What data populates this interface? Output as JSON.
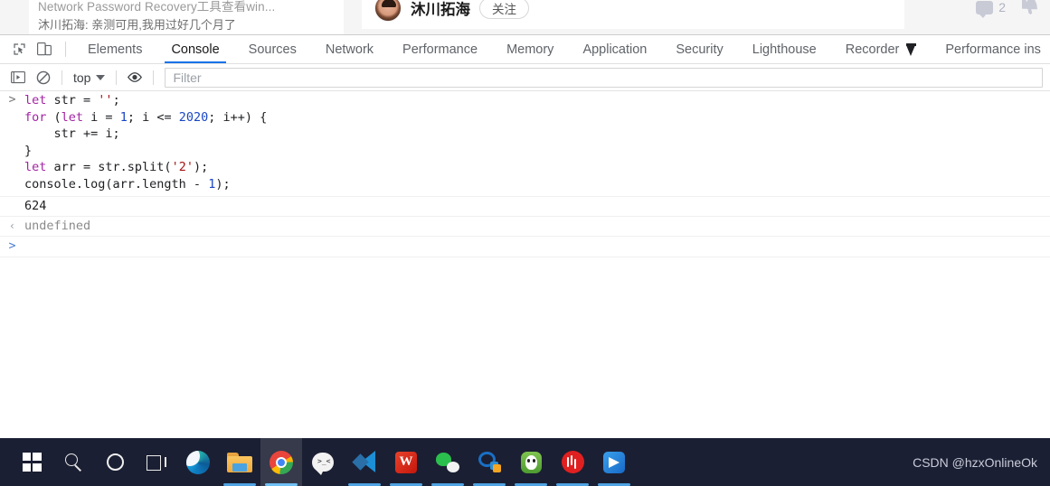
{
  "page": {
    "card_title": "Network Password Recovery工具查看win...",
    "card_subtitle": "沐川拓海: 亲测可用,我用过好几个月了",
    "username": "沐川拓海",
    "follow_label": "关注",
    "comment_count": "2"
  },
  "devtools": {
    "tabs": [
      {
        "label": "Elements",
        "active": false,
        "flask": false
      },
      {
        "label": "Console",
        "active": true,
        "flask": false
      },
      {
        "label": "Sources",
        "active": false,
        "flask": false
      },
      {
        "label": "Network",
        "active": false,
        "flask": false
      },
      {
        "label": "Performance",
        "active": false,
        "flask": false
      },
      {
        "label": "Memory",
        "active": false,
        "flask": false
      },
      {
        "label": "Application",
        "active": false,
        "flask": false
      },
      {
        "label": "Security",
        "active": false,
        "flask": false
      },
      {
        "label": "Lighthouse",
        "active": false,
        "flask": false
      },
      {
        "label": "Recorder",
        "active": false,
        "flask": true
      },
      {
        "label": "Performance ins",
        "active": false,
        "flask": false
      }
    ],
    "toolbar": {
      "context_label": "top",
      "filter_placeholder": "Filter",
      "filter_value": ""
    },
    "console": {
      "prompt_glyph": ">",
      "return_glyph": "‹",
      "input_lines": [
        {
          "tokens": [
            {
              "t": "let",
              "c": "kw"
            },
            {
              "t": " str = ",
              "c": "pl"
            },
            {
              "t": "''",
              "c": "str"
            },
            {
              "t": ";",
              "c": "pl"
            }
          ]
        },
        {
          "tokens": [
            {
              "t": "for",
              "c": "kw"
            },
            {
              "t": " (",
              "c": "pl"
            },
            {
              "t": "let",
              "c": "kw"
            },
            {
              "t": " i = ",
              "c": "pl"
            },
            {
              "t": "1",
              "c": "num"
            },
            {
              "t": "; i <= ",
              "c": "pl"
            },
            {
              "t": "2020",
              "c": "num"
            },
            {
              "t": "; i++) {",
              "c": "pl"
            }
          ]
        },
        {
          "tokens": [
            {
              "t": "    str += i;",
              "c": "pl"
            }
          ]
        },
        {
          "tokens": [
            {
              "t": "}",
              "c": "pl"
            }
          ]
        },
        {
          "tokens": [
            {
              "t": "let",
              "c": "kw"
            },
            {
              "t": " arr = str.split(",
              "c": "pl"
            },
            {
              "t": "'2'",
              "c": "str"
            },
            {
              "t": ");",
              "c": "pl"
            }
          ]
        },
        {
          "tokens": [
            {
              "t": "console.log(arr.length - ",
              "c": "pl"
            },
            {
              "t": "1",
              "c": "num"
            },
            {
              "t": ");",
              "c": "pl"
            }
          ]
        }
      ],
      "log_output": "624",
      "return_value": "undefined"
    }
  },
  "taskbar": {
    "items": [
      {
        "name": "start-button",
        "icon": "windows-logo-icon",
        "active": false,
        "running": false
      },
      {
        "name": "search-button",
        "icon": "search-icon",
        "active": false,
        "running": false
      },
      {
        "name": "cortana-button",
        "icon": "cortana-ring-icon",
        "active": false,
        "running": false
      },
      {
        "name": "task-view-button",
        "icon": "task-view-icon",
        "active": false,
        "running": false
      },
      {
        "name": "edge-button",
        "icon": "edge-icon",
        "active": false,
        "running": false
      },
      {
        "name": "file-explorer-button",
        "icon": "folder-icon",
        "active": false,
        "running": true
      },
      {
        "name": "chrome-button",
        "icon": "chrome-icon",
        "active": true,
        "running": true
      },
      {
        "name": "qq-chat-button",
        "icon": "chat-bubble-icon",
        "active": false,
        "running": false
      },
      {
        "name": "vscode-button",
        "icon": "vscode-icon",
        "active": false,
        "running": true
      },
      {
        "name": "wps-office-button",
        "icon": "wps-icon",
        "active": false,
        "running": true
      },
      {
        "name": "wechat-button",
        "icon": "wechat-icon",
        "active": false,
        "running": true
      },
      {
        "name": "tim-button",
        "icon": "tim-icon",
        "active": false,
        "running": true
      },
      {
        "name": "panda-browser-button",
        "icon": "panda-icon",
        "active": false,
        "running": true
      },
      {
        "name": "red-app-button",
        "icon": "red-circle-icon",
        "active": false,
        "running": true
      },
      {
        "name": "blue-arrow-button",
        "icon": "blue-arrow-icon",
        "active": false,
        "running": true
      }
    ],
    "watermark": "CSDN @hzxOnlineOk"
  }
}
